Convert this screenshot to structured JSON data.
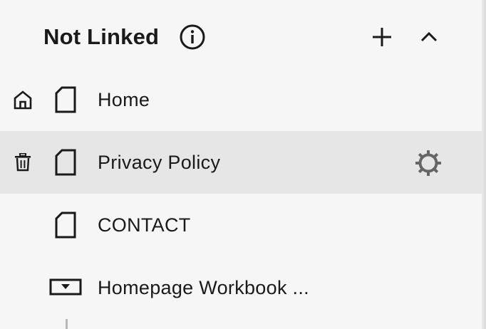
{
  "section": {
    "title": "Not Linked",
    "info_icon": "info-circle-icon",
    "add_icon": "plus-icon",
    "collapse_icon": "chevron-up-icon"
  },
  "pages": [
    {
      "label": "Home",
      "left_icon": "home-icon",
      "page_icon": "page-icon",
      "selected": false
    },
    {
      "label": "Privacy Policy",
      "left_icon": "trash-icon",
      "page_icon": "page-icon",
      "selected": true,
      "right_icon": "gear-icon"
    },
    {
      "label": "CONTACT",
      "page_icon": "page-icon",
      "selected": false
    },
    {
      "label": "Homepage Workbook ...",
      "page_icon": "dropdown-folder-icon",
      "selected": false
    }
  ],
  "colors": {
    "background": "#f6f6f6",
    "selected_row": "#e6e6e6",
    "text": "#1a1a1a",
    "gear": "#666666"
  }
}
